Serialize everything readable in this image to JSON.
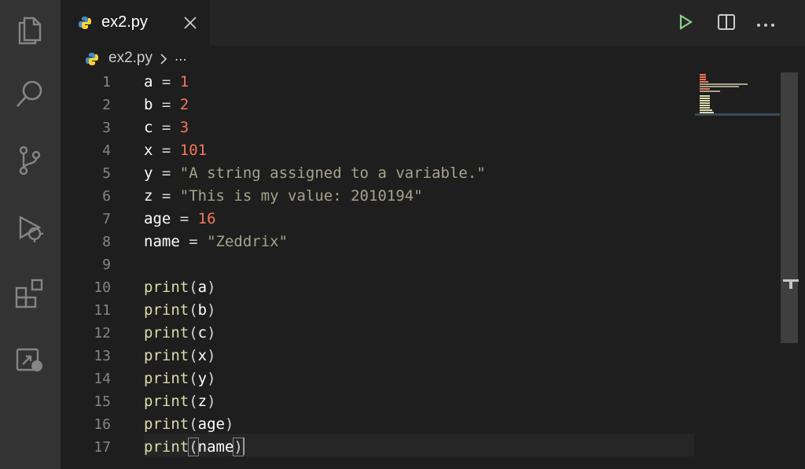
{
  "tab": {
    "filename": "ex2.py",
    "close_icon": "close-icon"
  },
  "toolbar": {
    "run_icon": "play-icon",
    "split_icon": "split-editor-icon",
    "more_icon": "ellipsis-icon"
  },
  "breadcrumb": {
    "file": "ex2.py",
    "more": "..."
  },
  "activity_bar": [
    {
      "name": "explorer-icon"
    },
    {
      "name": "search-icon"
    },
    {
      "name": "source-control-icon"
    },
    {
      "name": "run-debug-icon"
    },
    {
      "name": "extensions-icon"
    },
    {
      "name": "remote-explorer-icon"
    }
  ],
  "colors": {
    "number": "#f07858",
    "string": "#a6a38a",
    "function": "#dcdcaa",
    "line_number": "#858585",
    "run_green": "#89d185"
  },
  "code": {
    "line_numbers": [
      "1",
      "2",
      "3",
      "4",
      "5",
      "6",
      "7",
      "8",
      "9",
      "10",
      "11",
      "12",
      "13",
      "14",
      "15",
      "16",
      "17"
    ],
    "lines": [
      {
        "var": "a",
        "op": " = ",
        "num": "1"
      },
      {
        "var": "b",
        "op": " = ",
        "num": "2"
      },
      {
        "var": "c",
        "op": " = ",
        "num": "3"
      },
      {
        "var": "x",
        "op": " = ",
        "num": "101"
      },
      {
        "var": "y",
        "op": " = ",
        "str": "\"A string assigned to a variable.\""
      },
      {
        "var": "z",
        "op": " = ",
        "str": "\"This is my value: 2010194\""
      },
      {
        "var": "age",
        "op": " = ",
        "num": "16"
      },
      {
        "var": "name",
        "op": " = ",
        "str": "\"Zeddrix\""
      },
      {},
      {
        "fn": "print",
        "arg": "a"
      },
      {
        "fn": "print",
        "arg": "b"
      },
      {
        "fn": "print",
        "arg": "c"
      },
      {
        "fn": "print",
        "arg": "x"
      },
      {
        "fn": "print",
        "arg": "y"
      },
      {
        "fn": "print",
        "arg": "z"
      },
      {
        "fn": "print",
        "arg": "age"
      },
      {
        "fn": "print",
        "arg": "name"
      }
    ]
  }
}
